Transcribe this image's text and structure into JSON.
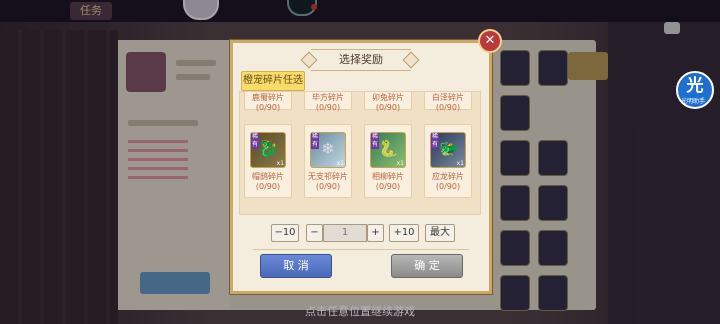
{
  "dialog": {
    "title": "选择奖励",
    "close_symbol": "✕",
    "subtab_label": "橙宠碎片任选",
    "top_row": [
      {
        "name": "鹿蜀碎片",
        "count": "(0/90)"
      },
      {
        "name": "毕方碎片",
        "count": "(0/90)"
      },
      {
        "name": "卯兔碎片",
        "count": "(0/90)"
      },
      {
        "name": "白泽碎片",
        "count": "(0/90)"
      }
    ],
    "cards": [
      {
        "name": "帽鸱碎片",
        "count": "(0/90)",
        "rarity": "稀有",
        "qty": "x1"
      },
      {
        "name": "无支祁碎片",
        "count": "(0/90)",
        "rarity": "稀有",
        "qty": "x1"
      },
      {
        "name": "相柳碎片",
        "count": "(0/90)",
        "rarity": "稀有",
        "qty": "x1"
      },
      {
        "name": "应龙碎片",
        "count": "(0/90)",
        "rarity": "稀有",
        "qty": "x1"
      }
    ],
    "stepper": {
      "minus10": "−10",
      "minus": "−",
      "value": "1",
      "plus": "+",
      "plus10": "+10",
      "max": "最大"
    },
    "cancel_label": "取 消",
    "confirm_label": "确 定"
  },
  "background": {
    "bottom_hint": "点击任意位置继续游戏",
    "badge_glyph": "光",
    "badge_sub": "光明助手",
    "tab_label": "任务"
  }
}
